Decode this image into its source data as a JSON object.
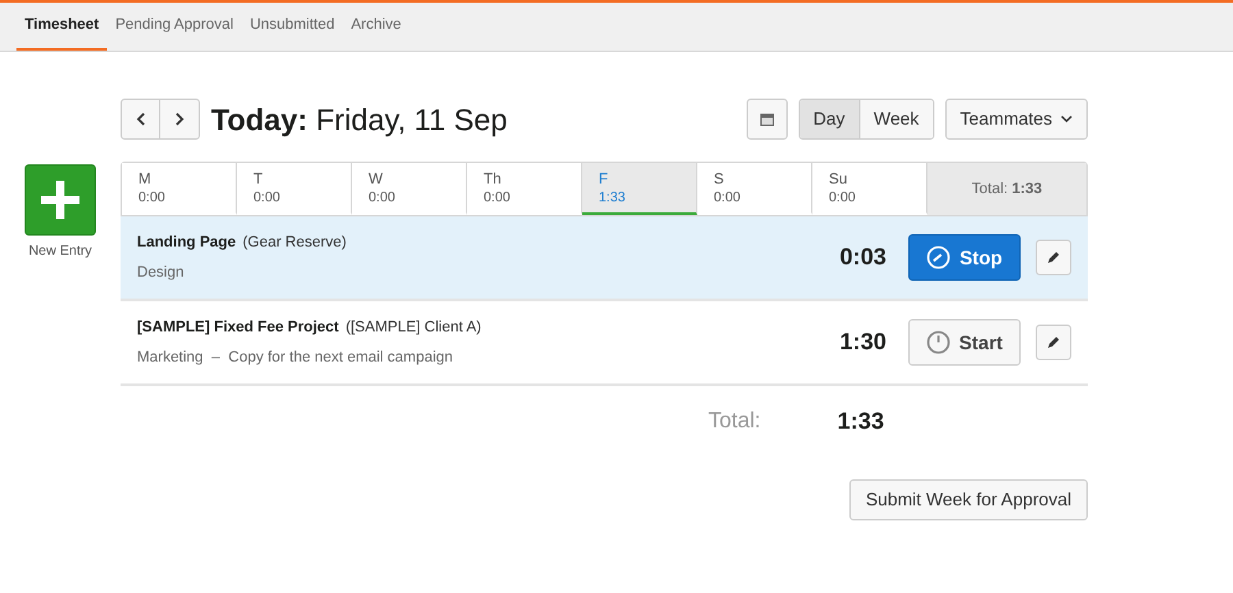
{
  "tabs": [
    {
      "label": "Timesheet",
      "selected": true
    },
    {
      "label": "Pending Approval",
      "selected": false
    },
    {
      "label": "Unsubmitted",
      "selected": false
    },
    {
      "label": "Archive",
      "selected": false
    }
  ],
  "new_entry": {
    "label": "New Entry"
  },
  "title": "**Today:** Friday, 11 Sep",
  "view_toggle": [
    {
      "label": "Day",
      "selected": true
    },
    {
      "label": "Week",
      "selected": false
    }
  ],
  "teammates": "Teammates",
  "days": [
    {
      "day": "M",
      "time": "0:00",
      "selected": false
    },
    {
      "day": "T",
      "time": "0:00",
      "selected": false
    },
    {
      "day": "W",
      "time": "0:00",
      "selected": false
    },
    {
      "day": "Th",
      "time": "0:00",
      "selected": false
    },
    {
      "day": "F",
      "time": "1:33",
      "selected": true
    },
    {
      "day": "S",
      "time": "0:00",
      "selected": false
    },
    {
      "day": "Su",
      "time": "0:00",
      "selected": false
    }
  ],
  "week_total": "Total: **1:33**",
  "entries": [
    {
      "project": "Landing Page",
      "client": "(Gear Reserve)",
      "details": "Design",
      "duration": "0:03",
      "running": true,
      "button": "Stop"
    },
    {
      "project": "[SAMPLE] Fixed Fee Project",
      "client": "([SAMPLE] Client A)",
      "details": "Marketing  –  Copy for the next email campaign",
      "duration": "1:30",
      "running": false,
      "button": "Start"
    }
  ],
  "total": {
    "label": "Total:",
    "value": "1:33"
  },
  "submit": "Submit Week for Approval"
}
